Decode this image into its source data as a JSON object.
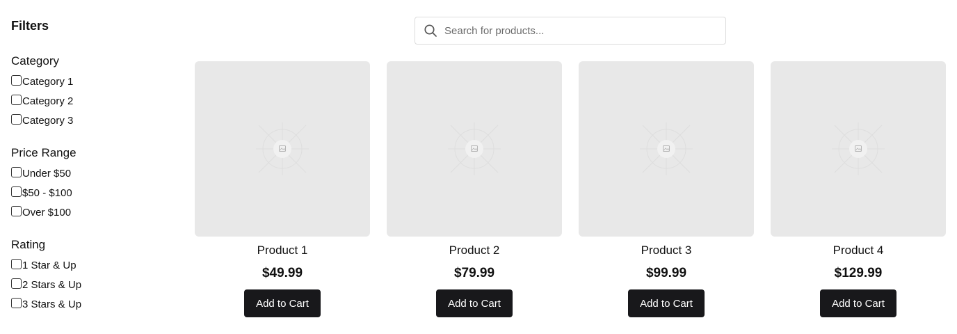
{
  "sidebar": {
    "title": "Filters",
    "groups": [
      {
        "title": "Category",
        "options": [
          "Category 1",
          "Category 2",
          "Category 3"
        ]
      },
      {
        "title": "Price Range",
        "options": [
          "Under $50",
          "$50 - $100",
          "Over $100"
        ]
      },
      {
        "title": "Rating",
        "options": [
          "1 Star & Up",
          "2 Stars & Up",
          "3 Stars & Up"
        ]
      }
    ]
  },
  "search": {
    "placeholder": "Search for products...",
    "value": "",
    "icon": "search-icon"
  },
  "products": [
    {
      "name": "Product 1",
      "price": "$49.99",
      "button": "Add to Cart",
      "image_icon": "image-placeholder-icon"
    },
    {
      "name": "Product 2",
      "price": "$79.99",
      "button": "Add to Cart",
      "image_icon": "image-placeholder-icon"
    },
    {
      "name": "Product 3",
      "price": "$99.99",
      "button": "Add to Cart",
      "image_icon": "image-placeholder-icon"
    },
    {
      "name": "Product 4",
      "price": "$129.99",
      "button": "Add to Cart",
      "image_icon": "image-placeholder-icon"
    }
  ],
  "colors": {
    "button_bg": "#18181b",
    "image_bg": "#e8e8e8",
    "search_border": "#dcdcdc"
  }
}
